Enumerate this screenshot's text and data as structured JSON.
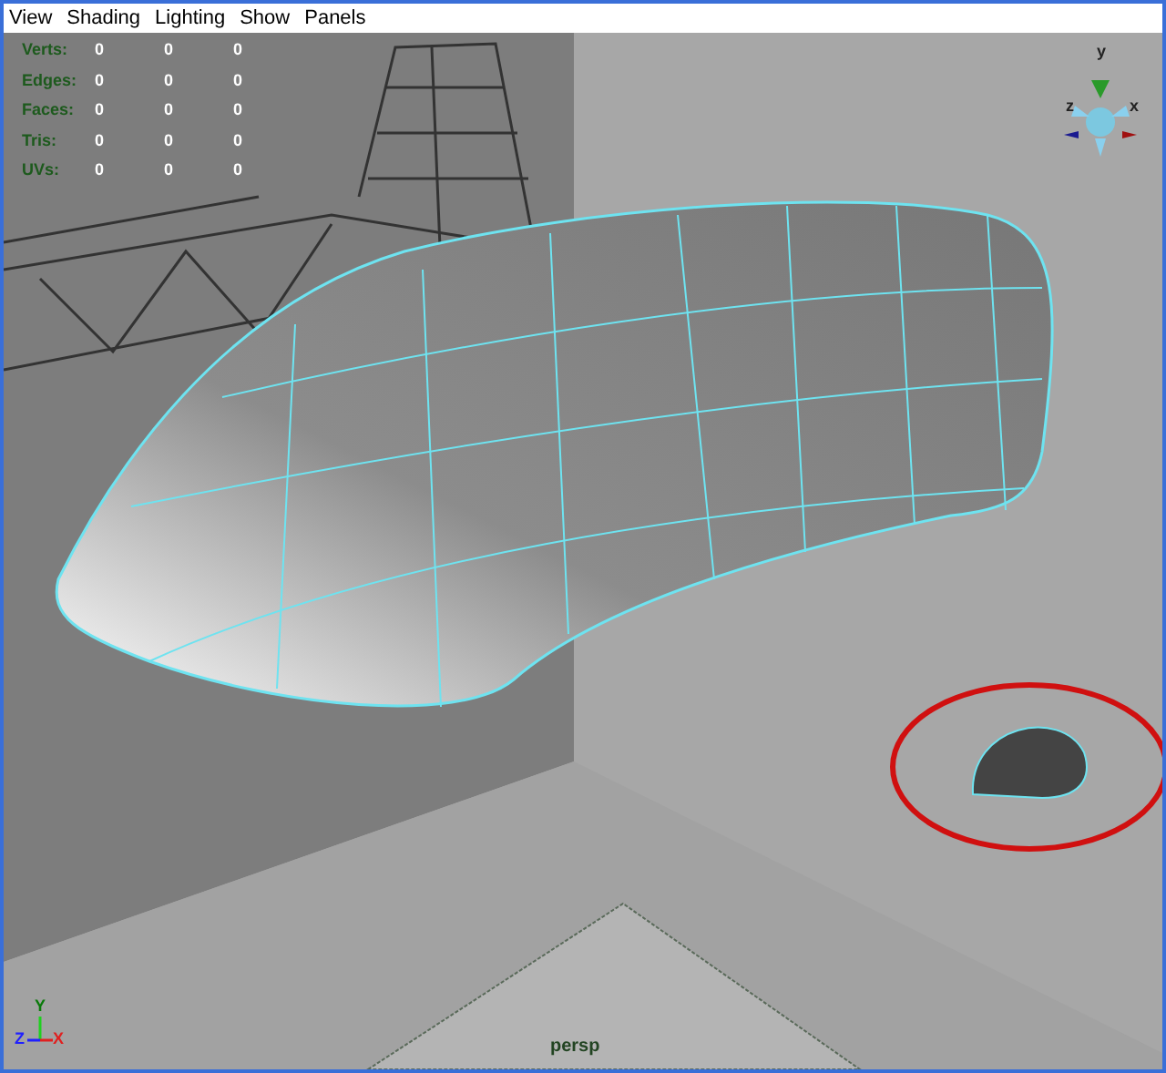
{
  "menu": [
    "View",
    "Shading",
    "Lighting",
    "Show",
    "Panels"
  ],
  "hud": [
    {
      "label": "Verts:",
      "values": [
        "0",
        "0",
        "0"
      ]
    },
    {
      "label": "Edges:",
      "values": [
        "0",
        "0",
        "0"
      ]
    },
    {
      "label": "Faces:",
      "values": [
        "0",
        "0",
        "0"
      ]
    },
    {
      "label": "Tris:",
      "values": [
        "0",
        "0",
        "0"
      ]
    },
    {
      "label": "UVs:",
      "values": [
        "0",
        "0",
        "0"
      ]
    }
  ],
  "view_cube": {
    "up": "y",
    "left": "z",
    "right": "x"
  },
  "axis": {
    "up": "Y",
    "left": "Z",
    "right": "X"
  },
  "camera": "persp"
}
